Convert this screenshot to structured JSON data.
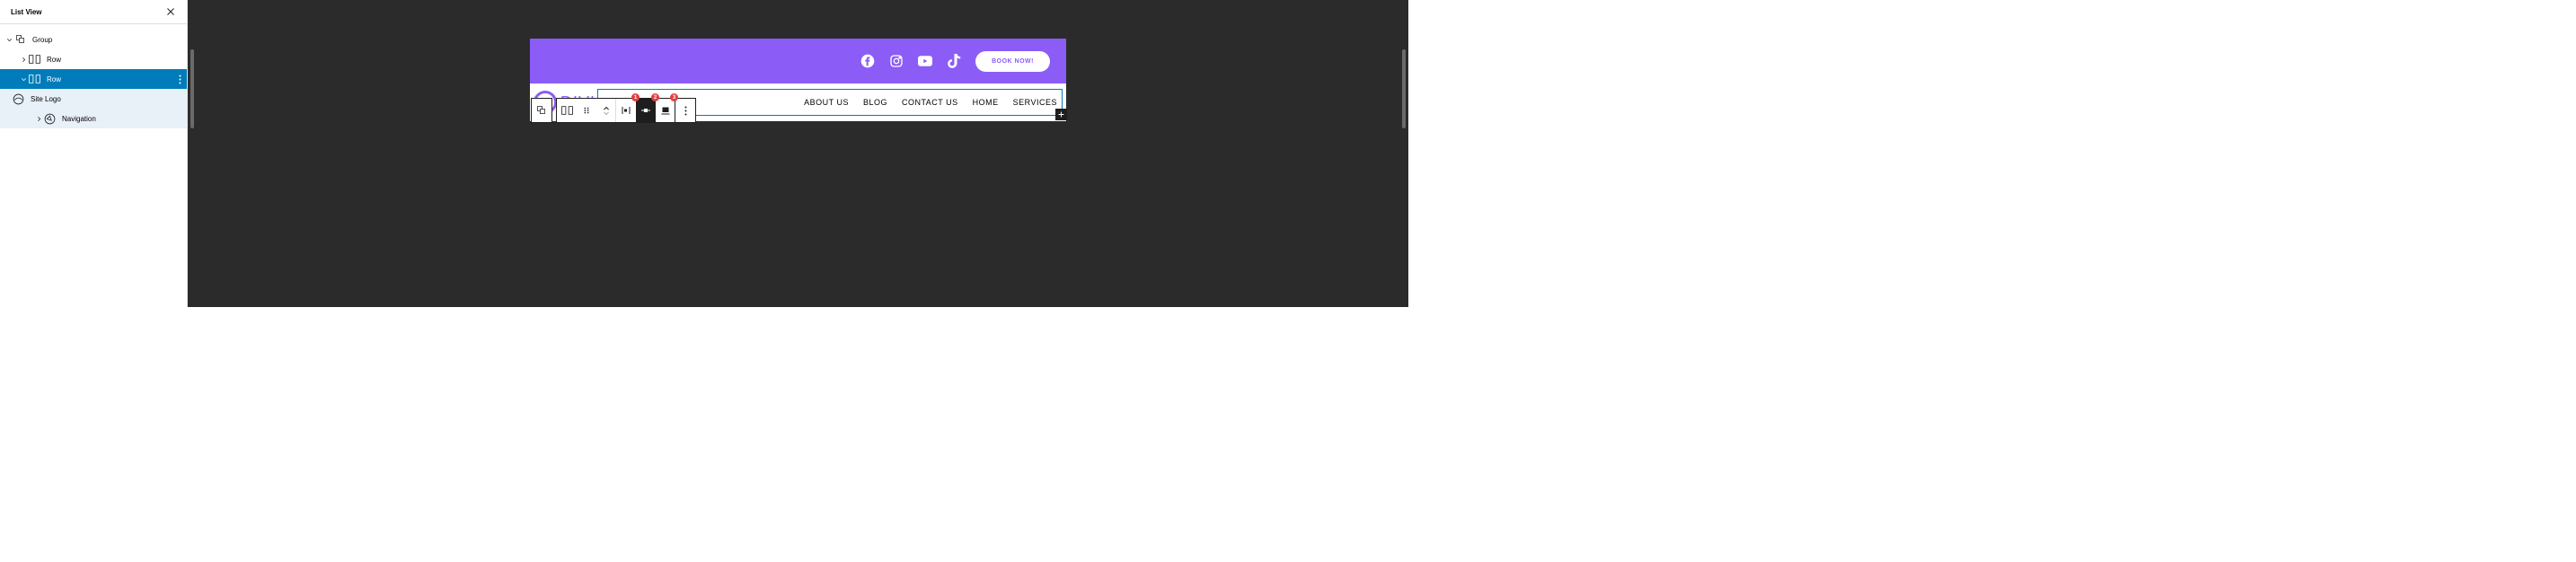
{
  "sidebar": {
    "title": "List View",
    "items": [
      {
        "label": "Group",
        "indent": 0,
        "expanded": true,
        "hasChildren": true
      },
      {
        "label": "Row",
        "indent": 1,
        "expanded": false,
        "hasChildren": true
      },
      {
        "label": "Row",
        "indent": 1,
        "expanded": true,
        "hasChildren": true,
        "selected": true
      },
      {
        "label": "Site Logo",
        "indent": 2,
        "childActive": true
      },
      {
        "label": "Navigation",
        "indent": 2,
        "hasChildren": true,
        "expanded": false,
        "childActive": true
      }
    ]
  },
  "toolbar": {
    "badges": [
      "1",
      "2",
      "3"
    ]
  },
  "header": {
    "book_label": "BOOK NOW!"
  },
  "logo": {
    "letter": "D",
    "text": "DIVI"
  },
  "nav": {
    "items": [
      "ABOUT US",
      "BLOG",
      "CONTACT US",
      "HOME",
      "SERVICES"
    ]
  }
}
